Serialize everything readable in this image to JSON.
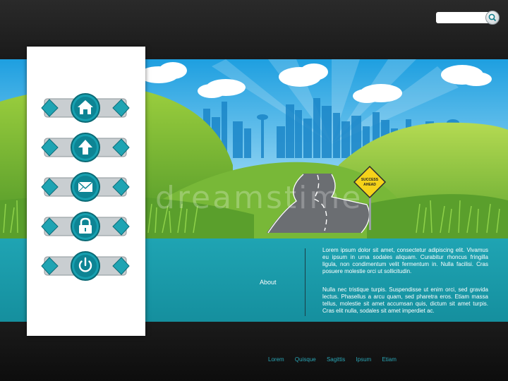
{
  "search": {
    "placeholder": ""
  },
  "banner": {
    "sign_line1": "SUCCESS",
    "sign_line2": "AHEAD"
  },
  "watermark": "dreamstime",
  "sidebar": {
    "buttons": [
      {
        "icon": "home-icon"
      },
      {
        "icon": "up-arrow-icon"
      },
      {
        "icon": "mail-icon"
      },
      {
        "icon": "lock-icon"
      },
      {
        "icon": "power-icon"
      }
    ]
  },
  "content": {
    "about_label": "About",
    "paragraph1": "Lorem ipsum dolor sit amet, consectetur adipiscing elit. Vivamus eu ipsum in urna sodales aliquam. Curabitur rhoncus fringilla ligula, non condimentum velit fermentum in. Nulla facilisi. Cras posuere molestie orci ut sollicitudin.",
    "paragraph2": "Nulla nec tristique turpis. Suspendisse ut enim orci, sed gravida lectus. Phasellus a arcu quam, sed pharetra eros. Etiam massa tellus, molestie sit amet accumsan quis, dictum sit amet turpis. Cras elit nulla, sodales sit amet imperdiet ac."
  },
  "footer": {
    "links": [
      "Lorem",
      "Quisque",
      "Sagittis",
      "Ipsum",
      "Etiam"
    ]
  },
  "colors": {
    "accent": "#1fa4b3",
    "topbar": "#222222",
    "footer_link": "#2aa6b6"
  }
}
